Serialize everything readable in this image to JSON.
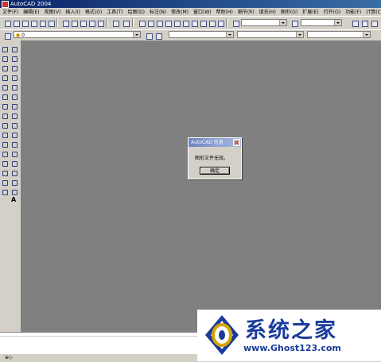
{
  "window": {
    "title": "AutoCAD 2004"
  },
  "menu": [
    "文件(F)",
    "编辑(E)",
    "视图(V)",
    "插入(I)",
    "格式(O)",
    "工具(T)",
    "绘图(D)",
    "标注(N)",
    "修改(M)",
    "窗口(W)",
    "帮助(H)",
    "细节(R)",
    "填充(H)",
    "图形(G)",
    "扩展(E)",
    "打开(O)",
    "功能(F)",
    "计算(C)"
  ],
  "layer": {
    "current": "0"
  },
  "drawing": {
    "background_color": "#808080"
  },
  "dialog": {
    "title": "AutoCAD 信息",
    "message": "图形文件无效。",
    "ok_label": "确定"
  },
  "left_toolbar": {
    "text_tool": "A"
  },
  "logo": {
    "text": "系统之家",
    "url": "www.Ghost123.com"
  }
}
